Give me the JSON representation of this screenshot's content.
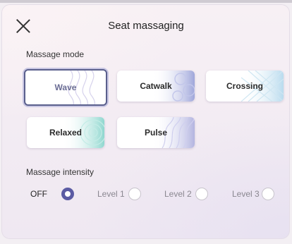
{
  "header": {
    "title": "Seat massaging"
  },
  "mode_section": {
    "label": "Massage mode",
    "options": [
      {
        "label": "Wave",
        "selected": true
      },
      {
        "label": "Catwalk",
        "selected": false
      },
      {
        "label": "Crossing",
        "selected": false
      },
      {
        "label": "Relaxed",
        "selected": false
      },
      {
        "label": "Pulse",
        "selected": false
      }
    ]
  },
  "intensity_section": {
    "label": "Massage intensity",
    "options": [
      {
        "label": "OFF",
        "selected": true
      },
      {
        "label": "Level 1",
        "selected": false
      },
      {
        "label": "Level 2",
        "selected": false
      },
      {
        "label": "Level 3",
        "selected": false
      }
    ]
  },
  "colors": {
    "accent": "#5b5ba3",
    "selected_border": "#5a5f8c"
  }
}
